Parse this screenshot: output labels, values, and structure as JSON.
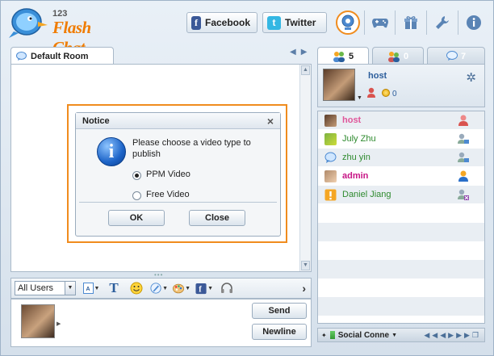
{
  "app": {
    "logo_number": "123",
    "logo_text": "Flash Chat"
  },
  "header": {
    "facebook_label": "Facebook",
    "facebook_glyph": "f",
    "twitter_label": "Twitter",
    "twitter_glyph": "t"
  },
  "room": {
    "tab_label": "Default Room"
  },
  "toolbar": {
    "target_select_value": "All Users",
    "font_icon_glyph": "T"
  },
  "input": {
    "send_label": "Send",
    "newline_label": "Newline"
  },
  "right_tabs": [
    {
      "icon": "users-icon",
      "count": "5"
    },
    {
      "icon": "rooms-icon",
      "count": "0"
    },
    {
      "icon": "chat-bubble-icon",
      "count": "7"
    }
  ],
  "profile": {
    "name": "host",
    "score": "0"
  },
  "users": [
    {
      "name": "host",
      "color": "#e0569a",
      "bold": true,
      "role_icon": "female-user-icon"
    },
    {
      "name": "July Zhu",
      "color": "#2e8a2e",
      "bold": false,
      "role_icon": "user-webcam-icon"
    },
    {
      "name": "zhu yin",
      "color": "#2e8a2e",
      "bold": false,
      "role_icon": "user-webcam-icon"
    },
    {
      "name": "admin",
      "color": "#c71585",
      "bold": true,
      "role_icon": "admin-user-icon"
    },
    {
      "name": "Daniel Jiang",
      "color": "#2e8a2e",
      "bold": false,
      "role_icon": "blocked-user-icon"
    }
  ],
  "status_bar": {
    "text": "Social Conne"
  },
  "notice": {
    "title": "Notice",
    "message": "Please choose a video type to publish",
    "option_ppm": "PPM Video",
    "option_free": "Free Video",
    "selected_option": "PPM Video",
    "ok_label": "OK",
    "close_label": "Close",
    "info_glyph": "i"
  },
  "colors": {
    "accent_orange": "#f08c1e",
    "link_blue": "#2b5d9b"
  }
}
